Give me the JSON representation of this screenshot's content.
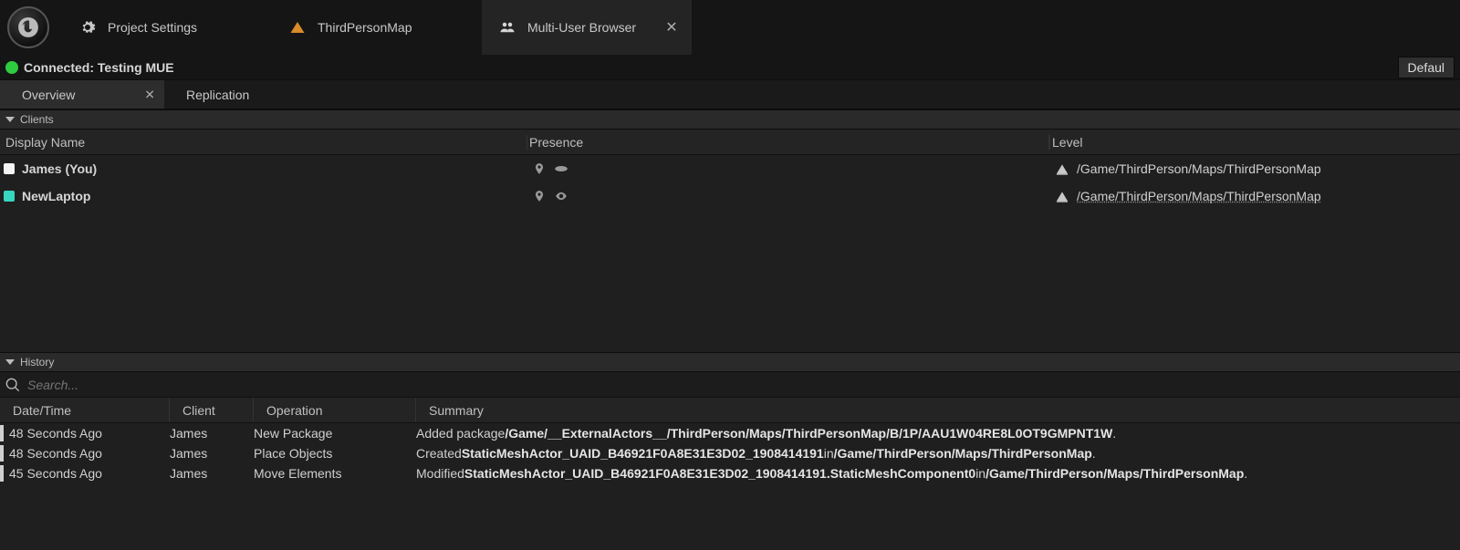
{
  "topTabs": [
    {
      "label": "Project Settings",
      "icon": "gear",
      "active": false,
      "closable": false
    },
    {
      "label": "ThirdPersonMap",
      "icon": "level",
      "active": false,
      "closable": false
    },
    {
      "label": "Multi-User Browser",
      "icon": "users",
      "active": true,
      "closable": true
    }
  ],
  "status": {
    "text": "Connected: Testing MUE",
    "colorHex": "#2ecc40",
    "rightCombo": "Defaul"
  },
  "subTabs": [
    {
      "label": "Overview",
      "active": true,
      "closable": true
    },
    {
      "label": "Replication",
      "active": false,
      "closable": false
    }
  ],
  "clientsSection": {
    "title": "Clients",
    "columns": {
      "displayName": "Display Name",
      "presence": "Presence",
      "level": "Level"
    },
    "rows": [
      {
        "swatchHex": "#f4f4f4",
        "name": "James (You)",
        "presenceIcons": [
          "pin",
          "disc"
        ],
        "level": "/Game/ThirdPerson/Maps/ThirdPersonMap",
        "levelLink": false
      },
      {
        "swatchHex": "#37d6c0",
        "name": "NewLaptop",
        "presenceIcons": [
          "pin",
          "eye"
        ],
        "level": "/Game/ThirdPerson/Maps/ThirdPersonMap",
        "levelLink": true
      }
    ]
  },
  "historySection": {
    "title": "History",
    "searchPlaceholder": "Search...",
    "columns": {
      "datetime": "Date/Time",
      "client": "Client",
      "operation": "Operation",
      "summary": "Summary"
    },
    "rows": [
      {
        "datetime": "48 Seconds Ago",
        "client": "James",
        "operation": "New Package",
        "summary": {
          "prefix": "Added package ",
          "bold1": "/Game/__ExternalActors__/ThirdPerson/Maps/ThirdPersonMap/B/1P/AAU1W04RE8L0OT9GMPNT1W",
          "mid": "",
          "bold2": "",
          "suffix": "."
        }
      },
      {
        "datetime": "48 Seconds Ago",
        "client": "James",
        "operation": "Place Objects",
        "summary": {
          "prefix": "Created ",
          "bold1": "StaticMeshActor_UAID_B46921F0A8E31E3D02_1908414191",
          "mid": " in ",
          "bold2": "/Game/ThirdPerson/Maps/ThirdPersonMap",
          "suffix": "."
        }
      },
      {
        "datetime": "45 Seconds Ago",
        "client": "James",
        "operation": "Move Elements",
        "summary": {
          "prefix": "Modified ",
          "bold1": "StaticMeshActor_UAID_B46921F0A8E31E3D02_1908414191.StaticMeshComponent0",
          "mid": " in ",
          "bold2": "/Game/ThirdPerson/Maps/ThirdPersonMap",
          "suffix": "."
        }
      }
    ]
  }
}
